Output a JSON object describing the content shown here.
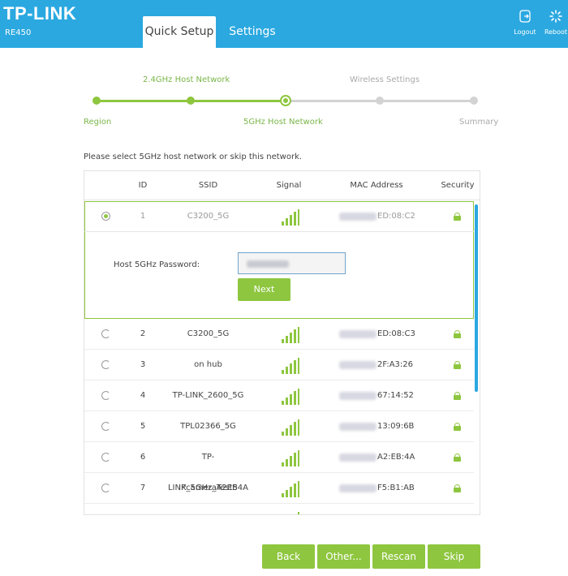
{
  "header": {
    "logo": "TP-LINK",
    "model": "RE450",
    "tabs": {
      "quick_setup": "Quick Setup",
      "settings": "Settings"
    },
    "logout_label": "Logout",
    "reboot_label": "Reboot"
  },
  "stepper": {
    "steps": [
      "Region",
      "2.4GHz Host Network",
      "5GHz Host Network",
      "Wireless Settings",
      "Summary"
    ],
    "current_step": 3
  },
  "instruction": "Please select 5GHz host network or skip this network.",
  "table": {
    "headers": {
      "id": "ID",
      "ssid": "SSID",
      "signal": "Signal",
      "mac": "MAC Address",
      "security": "Security"
    },
    "rows": [
      {
        "id": "1",
        "ssid": "C3200_5G",
        "mac_visible": "ED:08:C2",
        "selected": true
      },
      {
        "id": "2",
        "ssid": "C3200_5G",
        "mac_visible": "ED:08:C3"
      },
      {
        "id": "3",
        "ssid": "on hub",
        "mac_visible": "2F:A3:26"
      },
      {
        "id": "4",
        "ssid": "TP-LINK_2600_5G",
        "mac_visible": "67:14:52"
      },
      {
        "id": "5",
        "ssid": "TPL02366_5G",
        "mac_visible": "13:09:6B"
      },
      {
        "id": "6",
        "ssid": "TP-LINK_5GHz_A2EB4A",
        "mac_visible": "A2:EB:4A"
      },
      {
        "id": "7",
        "ssid": "IPcameraTest5",
        "mac_visible": "F5:B1:AB"
      }
    ],
    "password_label": "Host 5GHz Password:",
    "next_label": "Next"
  },
  "buttons": {
    "back": "Back",
    "other": "Other...",
    "rescan": "Rescan",
    "skip": "Skip"
  },
  "colors": {
    "header_blue": "#2ba8e0",
    "accent_green": "#8ec63f"
  }
}
